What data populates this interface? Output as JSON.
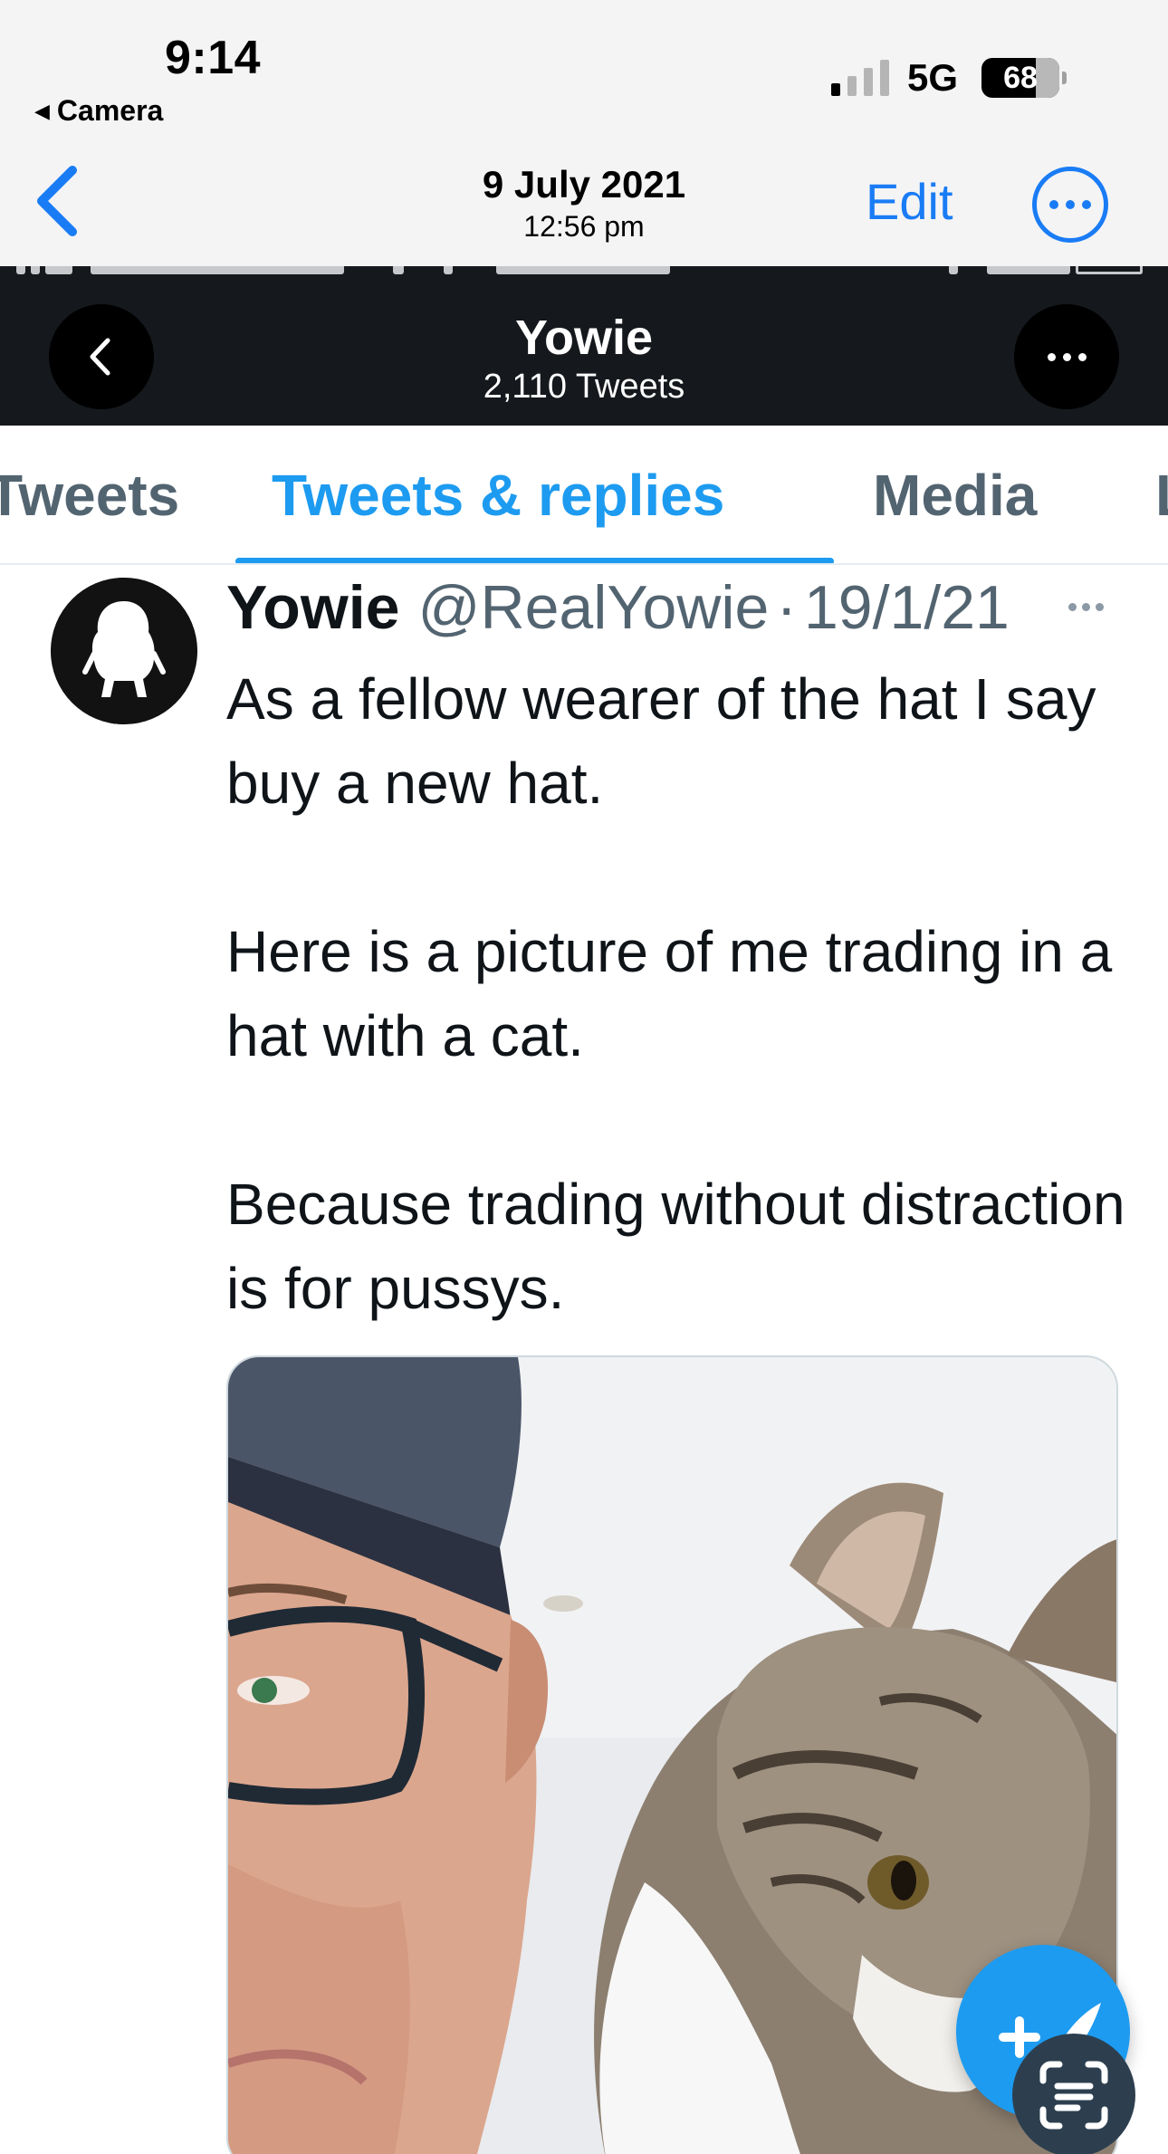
{
  "status_bar": {
    "time": "9:14",
    "back_app": "Camera",
    "network": "5G",
    "battery": "68"
  },
  "photos_header": {
    "date": "9 July 2021",
    "time": "12:56 pm",
    "edit_label": "Edit"
  },
  "profile_header": {
    "name": "Yowie",
    "tweet_count": "2,110 Tweets"
  },
  "tabs": [
    {
      "label": "Tweets"
    },
    {
      "label": "Tweets & replies",
      "active": true
    },
    {
      "label": "Media"
    },
    {
      "label": "Likes"
    }
  ],
  "tweet": {
    "author_name": "Yowie",
    "handle": "@RealYowie",
    "separator": "·",
    "date": "19/1/21",
    "paragraphs": [
      "As a fellow wearer of the hat I say buy a new hat.",
      "Here is a picture of me trading in a hat with a cat.",
      "Because trading without distraction is for pussys."
    ]
  },
  "colors": {
    "ios_accent": "#1a7cf5",
    "twitter_blue": "#1d9bf0",
    "dark_header": "#15181c",
    "secondary_text": "#536471"
  },
  "icons": [
    "chevron-left-icon",
    "more-circle-icon",
    "back-arrow-icon",
    "more-horizontal-icon",
    "compose-tweet-icon",
    "live-text-scan-icon",
    "signal-bars-icon",
    "battery-icon"
  ]
}
